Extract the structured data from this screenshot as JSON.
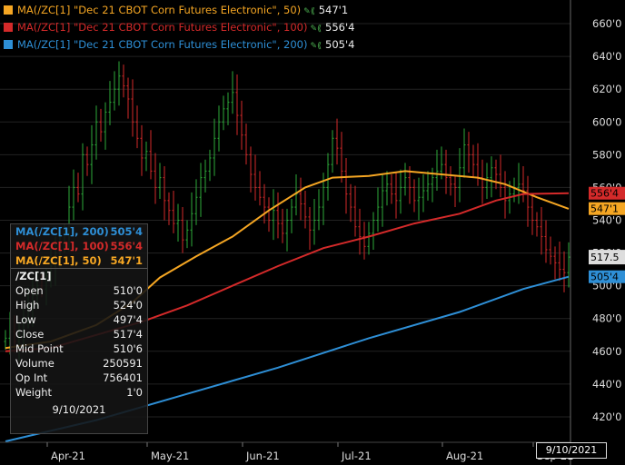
{
  "colors": {
    "ma50": "#f5a623",
    "ma100": "#d42a2a",
    "ma200": "#2e8fd6",
    "bull_bar": "#2eaa3a",
    "bear_bar": "#d42a2a",
    "close_tag_bg": "#dddddd"
  },
  "legend": [
    {
      "label": "MA(/ZC[1] \"Dec 21 CBOT Corn Futures Electronic\", 50)",
      "value": "547'1",
      "color": "#f5a623"
    },
    {
      "label": "MA(/ZC[1] \"Dec 21 CBOT Corn Futures Electronic\", 100)",
      "value": "556'4",
      "color": "#d42a2a"
    },
    {
      "label": "MA(/ZC[1] \"Dec 21 CBOT Corn Futures Electronic\", 200)",
      "value": "505'4",
      "color": "#2e8fd6"
    }
  ],
  "info_box": {
    "rows": [
      {
        "label": "MA(/ZC[1], 200)",
        "value": "505'4",
        "color": "#2e8fd6",
        "kind": "hdr"
      },
      {
        "label": "MA(/ZC[1], 100)",
        "value": "556'4",
        "color": "#d42a2a",
        "kind": "hdr"
      },
      {
        "label": "MA(/ZC[1], 50)",
        "value": "547'1",
        "color": "#f5a623",
        "kind": "hdr sep"
      },
      {
        "label": "/ZC[1]",
        "value": "",
        "color": "#eeeeee",
        "kind": "hdr"
      },
      {
        "label": "Open",
        "value": "510'0",
        "color": "#eeeeee",
        "kind": ""
      },
      {
        "label": "High",
        "value": "524'0",
        "color": "#eeeeee",
        "kind": ""
      },
      {
        "label": "Low",
        "value": "497'4",
        "color": "#eeeeee",
        "kind": ""
      },
      {
        "label": "Close",
        "value": "517'4",
        "color": "#eeeeee",
        "kind": ""
      },
      {
        "label": "Mid Point",
        "value": "510'6",
        "color": "#eeeeee",
        "kind": ""
      },
      {
        "label": "Volume",
        "value": "250591",
        "color": "#eeeeee",
        "kind": ""
      },
      {
        "label": "Op Int",
        "value": "756401",
        "color": "#eeeeee",
        "kind": ""
      },
      {
        "label": "Weight",
        "value": "1'0",
        "color": "#eeeeee",
        "kind": ""
      }
    ],
    "date": "9/10/2021"
  },
  "cursor_date": "9/10/2021",
  "chart_data": {
    "type": "line",
    "ylim": [
      405,
      670
    ],
    "y_ticks": [
      420,
      440,
      460,
      480,
      500,
      520,
      540,
      560,
      580,
      600,
      620,
      640,
      660
    ],
    "y_tick_labels": [
      "420'0",
      "440'0",
      "460'0",
      "480'0",
      "500'0",
      "520'0",
      "540'0",
      "560'0",
      "580'0",
      "600'0",
      "620'0",
      "640'0",
      "660'0"
    ],
    "x_labels": [
      "Apr-21",
      "May-21",
      "Jun-21",
      "Jul-21",
      "Aug-21",
      "Sep-21"
    ],
    "x_label_index": [
      10,
      32,
      53,
      74,
      97,
      117
    ],
    "n_bars": 125,
    "grid": true,
    "series": [
      {
        "name": "MA(/ZC[1] \"Dec 21 CBOT Corn Futures Electronic\", 50)",
        "color": "#f5a623",
        "points": [
          [
            0,
            462
          ],
          [
            10,
            466
          ],
          [
            20,
            476
          ],
          [
            28,
            490
          ],
          [
            34,
            505
          ],
          [
            42,
            518
          ],
          [
            50,
            530
          ],
          [
            58,
            546
          ],
          [
            66,
            560
          ],
          [
            72,
            566
          ],
          [
            80,
            567
          ],
          [
            88,
            570
          ],
          [
            96,
            568
          ],
          [
            104,
            566
          ],
          [
            110,
            562
          ],
          [
            117,
            554
          ],
          [
            124,
            547
          ]
        ]
      },
      {
        "name": "MA(/ZC[1] \"Dec 21 CBOT Corn Futures Electronic\", 100)",
        "color": "#d42a2a",
        "points": [
          [
            0,
            460
          ],
          [
            10,
            462
          ],
          [
            20,
            470
          ],
          [
            30,
            478
          ],
          [
            40,
            488
          ],
          [
            50,
            500
          ],
          [
            60,
            512
          ],
          [
            70,
            523
          ],
          [
            80,
            530
          ],
          [
            90,
            538
          ],
          [
            100,
            544
          ],
          [
            108,
            552
          ],
          [
            114,
            556
          ],
          [
            124,
            556.5
          ]
        ]
      },
      {
        "name": "MA(/ZC[1] \"Dec 21 CBOT Corn Futures Electronic\", 200)",
        "color": "#2e8fd6",
        "points": [
          [
            0,
            405
          ],
          [
            20,
            418
          ],
          [
            40,
            434
          ],
          [
            60,
            450
          ],
          [
            80,
            468
          ],
          [
            100,
            484
          ],
          [
            114,
            498
          ],
          [
            124,
            505.5
          ]
        ]
      }
    ],
    "closes": [
      468,
      472,
      466,
      470,
      480,
      486,
      494,
      500,
      498,
      506,
      512,
      520,
      526,
      532,
      548,
      560,
      556,
      580,
      574,
      586,
      600,
      594,
      606,
      612,
      620,
      628,
      622,
      614,
      600,
      590,
      578,
      582,
      570,
      560,
      566,
      552,
      546,
      538,
      540,
      528,
      534,
      544,
      554,
      566,
      570,
      578,
      590,
      600,
      608,
      612,
      618,
      604,
      592,
      580,
      568,
      560,
      554,
      548,
      540,
      546,
      538,
      532,
      540,
      548,
      556,
      550,
      542,
      534,
      540,
      548,
      560,
      574,
      590,
      584,
      570,
      556,
      548,
      536,
      530,
      524,
      532,
      540,
      548,
      558,
      562,
      556,
      552,
      560,
      566,
      560,
      552,
      554,
      558,
      562,
      566,
      570,
      574,
      566,
      562,
      560,
      572,
      586,
      580,
      574,
      566,
      560,
      566,
      572,
      568,
      560,
      552,
      556,
      560,
      562,
      558,
      548,
      540,
      536,
      530,
      522,
      518,
      514,
      510,
      508,
      517.5
    ],
    "last_close": 517.5,
    "last_close_label": "517.5",
    "value_tags": [
      {
        "value": 556.5,
        "label": "556'4",
        "color": "#d42a2a"
      },
      {
        "value": 547.1,
        "label": "547'1",
        "color": "#f5a623"
      },
      {
        "value": 505.5,
        "label": "505'4",
        "color": "#2e8fd6"
      }
    ]
  }
}
